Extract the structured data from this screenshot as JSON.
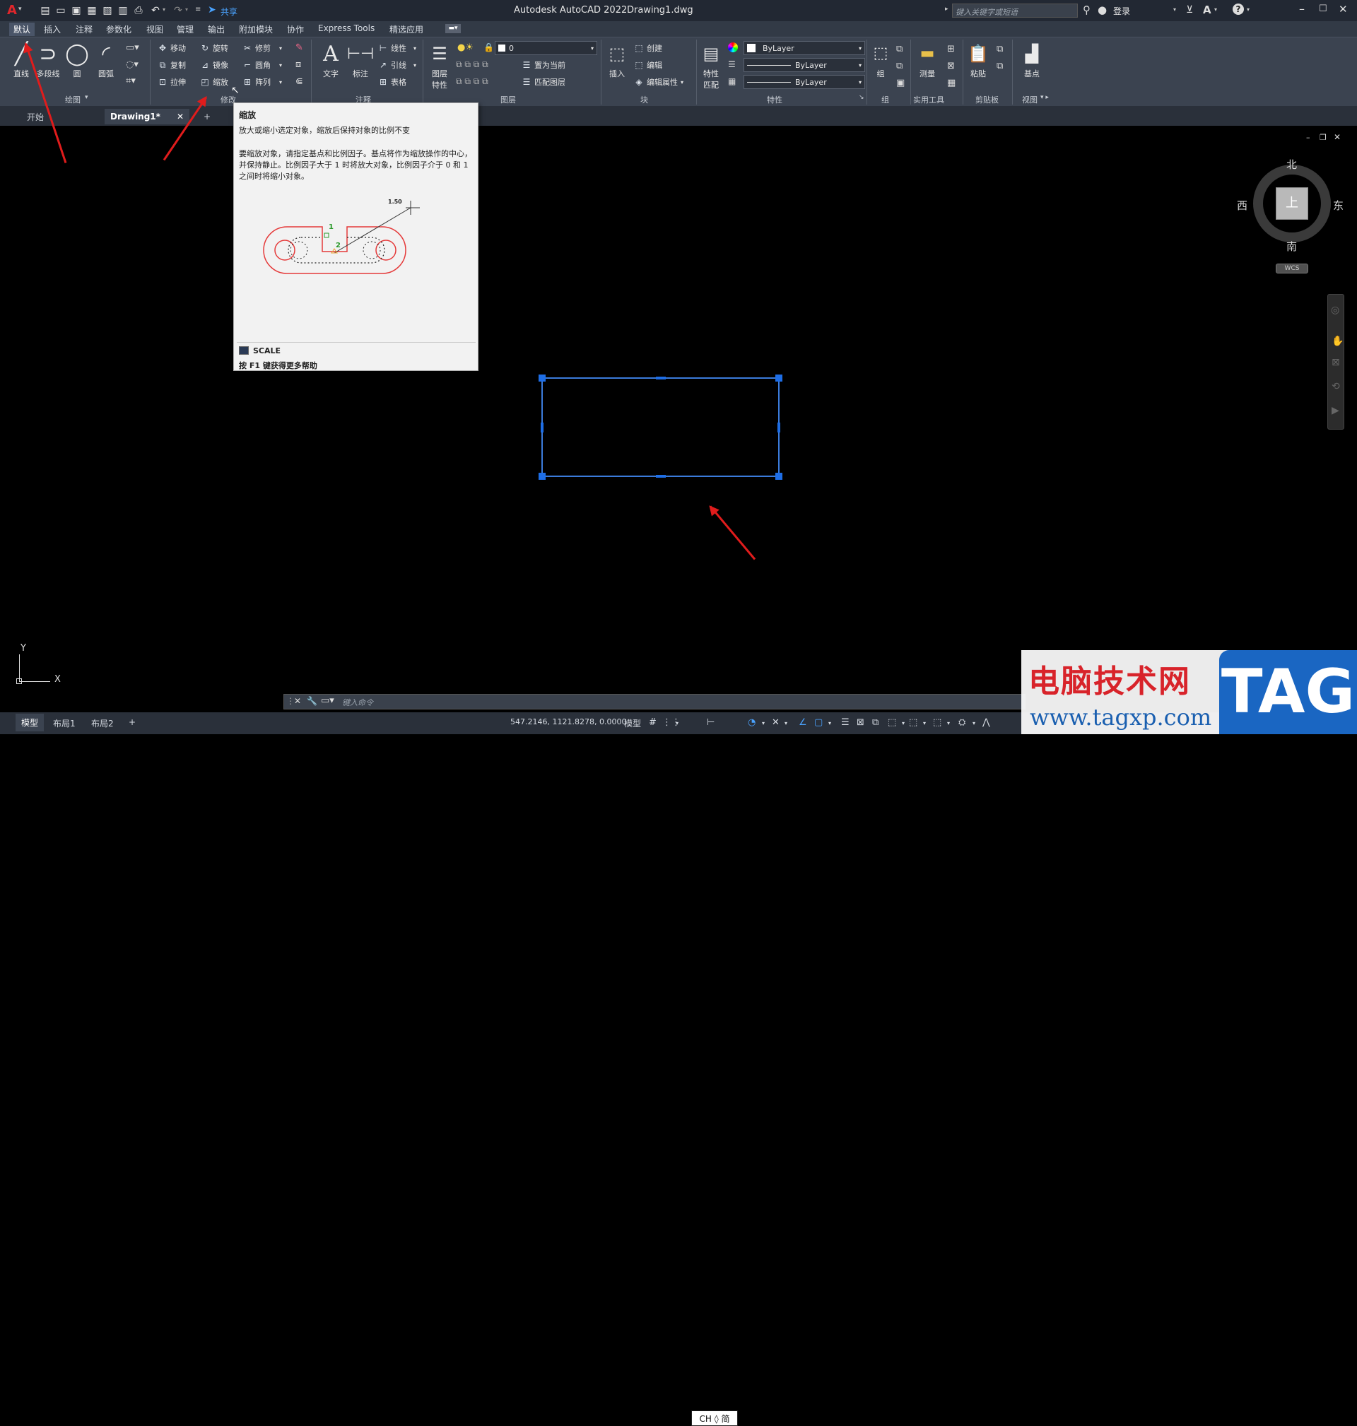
{
  "app": {
    "title": "Autodesk AutoCAD 2022",
    "doc_name": "Drawing1.dwg",
    "logo_letter": "A",
    "share_label": "共享",
    "search_placeholder": "键入关键字或短语",
    "login_label": "登录"
  },
  "menu": [
    "默认",
    "插入",
    "注释",
    "参数化",
    "视图",
    "管理",
    "输出",
    "附加模块",
    "协作",
    "Express Tools",
    "精选应用"
  ],
  "ribbon": {
    "draw": {
      "line": "直线",
      "polyline": "多段线",
      "circle": "圆",
      "arc": "圆弧",
      "label": "绘图"
    },
    "modify": {
      "move": "移动",
      "rotate": "旋转",
      "trim": "修剪",
      "copy": "复制",
      "mirror": "镜像",
      "fillet": "圆角",
      "stretch": "拉伸",
      "scale": "缩放",
      "array": "阵列",
      "label": "修改"
    },
    "annotation": {
      "text": "文字",
      "dimension": "标注",
      "linear": "线性",
      "leader": "引线",
      "table": "表格",
      "label": "注释"
    },
    "layers": {
      "properties_line1": "图层",
      "properties_line2": "特性",
      "layer_value": "0",
      "set_current": "置为当前",
      "match_layer": "匹配图层",
      "label": "图层"
    },
    "block": {
      "insert": "插入",
      "create": "创建",
      "edit": "编辑",
      "edit_attr": "编辑属性",
      "label": "块"
    },
    "properties": {
      "match_line1": "特性",
      "match_line2": "匹配",
      "color": "ByLayer",
      "linetype": "ByLayer",
      "lineweight": "ByLayer",
      "label": "特性"
    },
    "groups": {
      "group": "组",
      "label": "组"
    },
    "utilities": {
      "measure": "测量",
      "label": "实用工具"
    },
    "clipboard": {
      "paste": "粘贴",
      "label": "剪贴板"
    },
    "view": {
      "base": "基点",
      "label": "视图"
    }
  },
  "doc_tabs": {
    "start": "开始",
    "drawing": "Drawing1*",
    "plus": "+"
  },
  "tooltip": {
    "title": "缩放",
    "desc": "放大或缩小选定对象，缩放后保持对象的比例不变",
    "body": "要缩放对象，请指定基点和比例因子。基点将作为缩放操作的中心，并保持静止。比例因子大于 1 时将放大对象，比例因子介于 0 和 1 之间时将缩小对象。",
    "command": "SCALE",
    "help": "按 F1 键获得更多帮助",
    "figure_scale": "1.50",
    "figure_p1": "1",
    "figure_p2": "2"
  },
  "viewcube": {
    "north": "北",
    "south": "南",
    "east": "东",
    "west": "西",
    "top": "上",
    "wcs": "WCS"
  },
  "ucs": {
    "x": "X",
    "y": "Y"
  },
  "command_line": {
    "placeholder": "键入命令"
  },
  "status": {
    "tabs": [
      "模型",
      "布局1",
      "布局2"
    ],
    "plus": "+",
    "coords": "547.2146, 1121.8278, 0.0000",
    "model": "模型",
    "ime": "CH ◊ 简"
  },
  "watermark": {
    "text1": "电脑技术网",
    "url": "www.tagxp.com",
    "logo": "TAG"
  },
  "colors": {
    "accent": "#3c8cff",
    "arrow": "#e01c1c",
    "selection": "#3b7bdb"
  }
}
